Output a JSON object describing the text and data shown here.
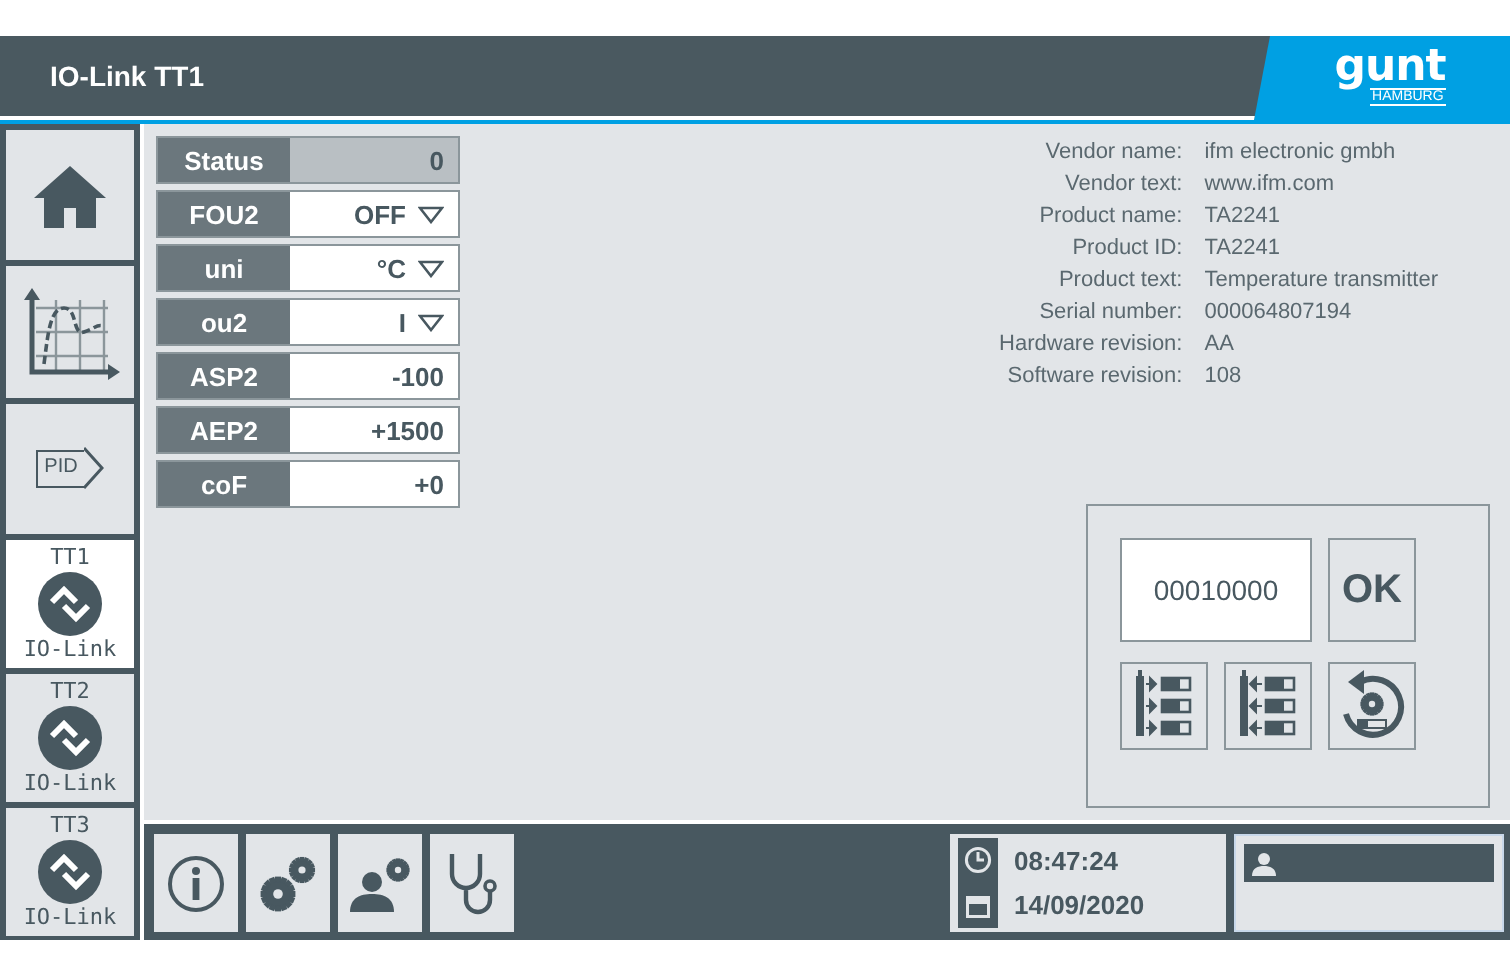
{
  "window": {
    "title": "IO-Link TT1"
  },
  "logo": {
    "brand": "gunt",
    "city": "HAMBURG"
  },
  "nav": [
    {
      "kind": "home",
      "selected": false
    },
    {
      "kind": "chart",
      "selected": false
    },
    {
      "kind": "pid",
      "label": "PID",
      "selected": false
    },
    {
      "kind": "device",
      "top": "TT1",
      "bottom": "IO-Link",
      "selected": true
    },
    {
      "kind": "device",
      "top": "TT2",
      "bottom": "IO-Link",
      "selected": false
    },
    {
      "kind": "device",
      "top": "TT3",
      "bottom": "IO-Link",
      "selected": false
    }
  ],
  "parameters": [
    {
      "name": "Status",
      "value": "0",
      "kind": "readout"
    },
    {
      "name": "FOU2",
      "value": "OFF",
      "kind": "dropdown"
    },
    {
      "name": "uni",
      "value": "°C",
      "kind": "dropdown"
    },
    {
      "name": "ou2",
      "value": "I",
      "kind": "dropdown"
    },
    {
      "name": "ASP2",
      "value": "-100",
      "kind": "input"
    },
    {
      "name": "AEP2",
      "value": "+1500",
      "kind": "input"
    },
    {
      "name": "coF",
      "value": "+0",
      "kind": "input"
    }
  ],
  "device_info": [
    {
      "label": "Vendor name:",
      "value": "ifm electronic gmbh"
    },
    {
      "label": "Vendor text:",
      "value": "www.ifm.com"
    },
    {
      "label": "Product name:",
      "value": "TA2241"
    },
    {
      "label": "Product ID:",
      "value": "TA2241"
    },
    {
      "label": "Product text:",
      "value": "Temperature transmitter"
    },
    {
      "label": "Serial number:",
      "value": "000064807194"
    },
    {
      "label": "Hardware revision:",
      "value": "AA"
    },
    {
      "label": "Software revision:",
      "value": "108"
    }
  ],
  "controls": {
    "code": "00010000",
    "ok": "OK",
    "actions": [
      {
        "kind": "download"
      },
      {
        "kind": "upload"
      },
      {
        "kind": "reset"
      }
    ]
  },
  "toolbar": [
    {
      "kind": "info"
    },
    {
      "kind": "settings"
    },
    {
      "kind": "user-settings"
    },
    {
      "kind": "diagnosis"
    }
  ],
  "clock": {
    "time": "08:47:24",
    "date": "14/09/2020"
  }
}
